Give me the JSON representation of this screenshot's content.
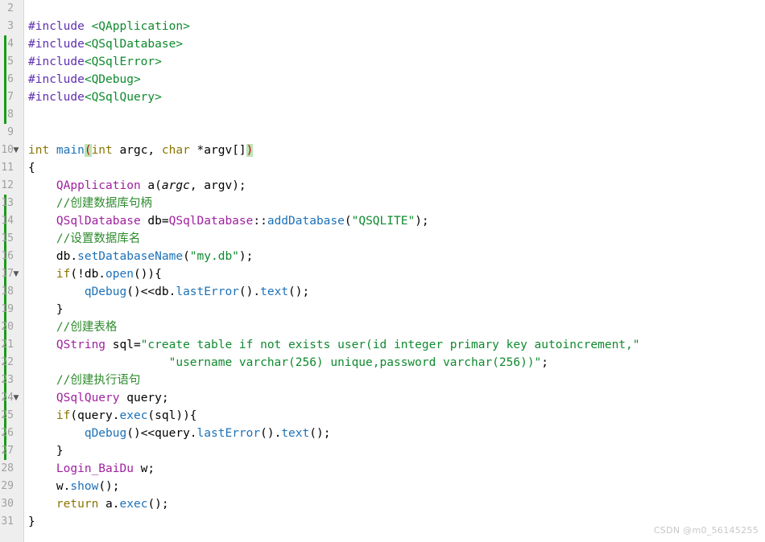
{
  "editor": {
    "app": "Qt Creator code editor",
    "language": "C++",
    "background": "#ffffff",
    "gutter_background": "#eeeeee",
    "change_marker_color": "#1a9b1a",
    "match_bracket_bg": "#b8e6b8",
    "match_bracket_fg": "#d40000"
  },
  "gutter": {
    "fold_glyph": "▼",
    "lines": [
      {
        "n": "2",
        "changed": false,
        "fold": false
      },
      {
        "n": "3",
        "changed": false,
        "fold": false
      },
      {
        "n": "4",
        "changed": true,
        "fold": false
      },
      {
        "n": "5",
        "changed": true,
        "fold": false
      },
      {
        "n": "6",
        "changed": true,
        "fold": false
      },
      {
        "n": "7",
        "changed": true,
        "fold": false
      },
      {
        "n": "8",
        "changed": true,
        "fold": false
      },
      {
        "n": "9",
        "changed": false,
        "fold": false
      },
      {
        "n": "10",
        "changed": false,
        "fold": true
      },
      {
        "n": "11",
        "changed": false,
        "fold": false
      },
      {
        "n": "12",
        "changed": false,
        "fold": false
      },
      {
        "n": "13",
        "changed": true,
        "fold": false
      },
      {
        "n": "14",
        "changed": true,
        "fold": false
      },
      {
        "n": "15",
        "changed": true,
        "fold": false
      },
      {
        "n": "16",
        "changed": true,
        "fold": false
      },
      {
        "n": "17",
        "changed": true,
        "fold": true
      },
      {
        "n": "18",
        "changed": true,
        "fold": false
      },
      {
        "n": "19",
        "changed": true,
        "fold": false
      },
      {
        "n": "20",
        "changed": true,
        "fold": false
      },
      {
        "n": "21",
        "changed": true,
        "fold": false
      },
      {
        "n": "22",
        "changed": true,
        "fold": false
      },
      {
        "n": "23",
        "changed": true,
        "fold": false
      },
      {
        "n": "24",
        "changed": true,
        "fold": true
      },
      {
        "n": "25",
        "changed": true,
        "fold": false
      },
      {
        "n": "26",
        "changed": true,
        "fold": false
      },
      {
        "n": "27",
        "changed": true,
        "fold": false
      },
      {
        "n": "28",
        "changed": false,
        "fold": false
      },
      {
        "n": "29",
        "changed": false,
        "fold": false
      },
      {
        "n": "30",
        "changed": false,
        "fold": false
      },
      {
        "n": "31",
        "changed": false,
        "fold": false
      }
    ]
  },
  "code": {
    "lines": [
      {
        "id": "l2",
        "tokens": []
      },
      {
        "id": "l3",
        "tokens": [
          {
            "t": "#include ",
            "c": "t-pp"
          },
          {
            "t": "<QApplication>",
            "c": "t-header"
          }
        ]
      },
      {
        "id": "l4",
        "tokens": [
          {
            "t": "#include",
            "c": "t-pp"
          },
          {
            "t": "<QSqlDatabase>",
            "c": "t-header"
          }
        ]
      },
      {
        "id": "l5",
        "tokens": [
          {
            "t": "#include",
            "c": "t-pp"
          },
          {
            "t": "<QSqlError>",
            "c": "t-header"
          }
        ]
      },
      {
        "id": "l6",
        "tokens": [
          {
            "t": "#include",
            "c": "t-pp"
          },
          {
            "t": "<QDebug>",
            "c": "t-header"
          }
        ]
      },
      {
        "id": "l7",
        "tokens": [
          {
            "t": "#include",
            "c": "t-pp"
          },
          {
            "t": "<QSqlQuery>",
            "c": "t-header"
          }
        ]
      },
      {
        "id": "l8",
        "tokens": []
      },
      {
        "id": "l9",
        "tokens": []
      },
      {
        "id": "l10",
        "tokens": [
          {
            "t": "int ",
            "c": "t-keyword"
          },
          {
            "t": "main",
            "c": "t-func"
          },
          {
            "t": "(",
            "c": "t-match"
          },
          {
            "t": "int",
            "c": "t-keyword"
          },
          {
            "t": " argc, ",
            "c": "t-plain"
          },
          {
            "t": "char",
            "c": "t-keyword"
          },
          {
            "t": " *argv[]",
            "c": "t-plain"
          },
          {
            "t": ")",
            "c": "t-match"
          }
        ]
      },
      {
        "id": "l11",
        "tokens": [
          {
            "t": "{",
            "c": "t-plain"
          }
        ]
      },
      {
        "id": "l12",
        "tokens": [
          {
            "t": "    ",
            "c": "t-plain"
          },
          {
            "t": "QApplication",
            "c": "t-class"
          },
          {
            "t": " a(",
            "c": "t-plain"
          },
          {
            "t": "argc",
            "c": "t-param"
          },
          {
            "t": ", argv);",
            "c": "t-plain"
          }
        ]
      },
      {
        "id": "l13",
        "tokens": [
          {
            "t": "    //创建数据库句柄",
            "c": "t-comment"
          }
        ]
      },
      {
        "id": "l14",
        "tokens": [
          {
            "t": "    ",
            "c": "t-plain"
          },
          {
            "t": "QSqlDatabase",
            "c": "t-class"
          },
          {
            "t": " db=",
            "c": "t-plain"
          },
          {
            "t": "QSqlDatabase",
            "c": "t-class"
          },
          {
            "t": "::",
            "c": "t-plain"
          },
          {
            "t": "addDatabase",
            "c": "t-func"
          },
          {
            "t": "(",
            "c": "t-plain"
          },
          {
            "t": "\"QSQLITE\"",
            "c": "t-string"
          },
          {
            "t": ");",
            "c": "t-plain"
          }
        ]
      },
      {
        "id": "l15",
        "tokens": [
          {
            "t": "    //设置数据库名",
            "c": "t-comment"
          }
        ]
      },
      {
        "id": "l16",
        "tokens": [
          {
            "t": "    db.",
            "c": "t-plain"
          },
          {
            "t": "setDatabaseName",
            "c": "t-func"
          },
          {
            "t": "(",
            "c": "t-plain"
          },
          {
            "t": "\"my.db\"",
            "c": "t-string"
          },
          {
            "t": ");",
            "c": "t-plain"
          }
        ]
      },
      {
        "id": "l17",
        "tokens": [
          {
            "t": "    ",
            "c": "t-plain"
          },
          {
            "t": "if",
            "c": "t-keyword"
          },
          {
            "t": "(!db.",
            "c": "t-plain"
          },
          {
            "t": "open",
            "c": "t-func"
          },
          {
            "t": "()){",
            "c": "t-plain"
          }
        ]
      },
      {
        "id": "l18",
        "tokens": [
          {
            "t": "        ",
            "c": "t-plain"
          },
          {
            "t": "qDebug",
            "c": "t-func"
          },
          {
            "t": "()<<db.",
            "c": "t-plain"
          },
          {
            "t": "lastError",
            "c": "t-func"
          },
          {
            "t": "().",
            "c": "t-plain"
          },
          {
            "t": "text",
            "c": "t-func"
          },
          {
            "t": "();",
            "c": "t-plain"
          }
        ]
      },
      {
        "id": "l19",
        "tokens": [
          {
            "t": "    }",
            "c": "t-plain"
          }
        ]
      },
      {
        "id": "l20",
        "tokens": [
          {
            "t": "    //创建表格",
            "c": "t-comment"
          }
        ]
      },
      {
        "id": "l21",
        "tokens": [
          {
            "t": "    ",
            "c": "t-plain"
          },
          {
            "t": "QString",
            "c": "t-class"
          },
          {
            "t": " sql=",
            "c": "t-plain"
          },
          {
            "t": "\"create table if not exists user(id integer primary key autoincrement,\"",
            "c": "t-string"
          }
        ]
      },
      {
        "id": "l22",
        "tokens": [
          {
            "t": "                    ",
            "c": "t-plain"
          },
          {
            "t": "\"username varchar(256) unique,password varchar(256))\"",
            "c": "t-string"
          },
          {
            "t": ";",
            "c": "t-plain"
          }
        ]
      },
      {
        "id": "l23",
        "tokens": [
          {
            "t": "    //创建执行语句",
            "c": "t-comment"
          }
        ]
      },
      {
        "id": "l24",
        "tokens": [
          {
            "t": "    ",
            "c": "t-plain"
          },
          {
            "t": "QSqlQuery",
            "c": "t-class"
          },
          {
            "t": " query;",
            "c": "t-plain"
          }
        ]
      },
      {
        "id": "l25",
        "tokens": [
          {
            "t": "    ",
            "c": "t-plain"
          },
          {
            "t": "if",
            "c": "t-keyword"
          },
          {
            "t": "(query.",
            "c": "t-plain"
          },
          {
            "t": "exec",
            "c": "t-func"
          },
          {
            "t": "(sql)){",
            "c": "t-plain"
          }
        ]
      },
      {
        "id": "l26",
        "tokens": [
          {
            "t": "        ",
            "c": "t-plain"
          },
          {
            "t": "qDebug",
            "c": "t-func"
          },
          {
            "t": "()<<query.",
            "c": "t-plain"
          },
          {
            "t": "lastError",
            "c": "t-func"
          },
          {
            "t": "().",
            "c": "t-plain"
          },
          {
            "t": "text",
            "c": "t-func"
          },
          {
            "t": "();",
            "c": "t-plain"
          }
        ]
      },
      {
        "id": "l27",
        "tokens": [
          {
            "t": "    }",
            "c": "t-plain"
          }
        ]
      },
      {
        "id": "l28",
        "tokens": [
          {
            "t": "    ",
            "c": "t-plain"
          },
          {
            "t": "Login_BaiDu",
            "c": "t-class"
          },
          {
            "t": " w;",
            "c": "t-plain"
          }
        ]
      },
      {
        "id": "l29",
        "tokens": [
          {
            "t": "    w.",
            "c": "t-plain"
          },
          {
            "t": "show",
            "c": "t-func"
          },
          {
            "t": "();",
            "c": "t-plain"
          }
        ]
      },
      {
        "id": "l30",
        "tokens": [
          {
            "t": "    ",
            "c": "t-plain"
          },
          {
            "t": "return",
            "c": "t-keyword"
          },
          {
            "t": " a.",
            "c": "t-plain"
          },
          {
            "t": "exec",
            "c": "t-func"
          },
          {
            "t": "();",
            "c": "t-plain"
          }
        ]
      },
      {
        "id": "l31",
        "tokens": [
          {
            "t": "}",
            "c": "t-plain"
          }
        ]
      }
    ]
  },
  "watermark": {
    "text": "CSDN @m0_56145255"
  }
}
